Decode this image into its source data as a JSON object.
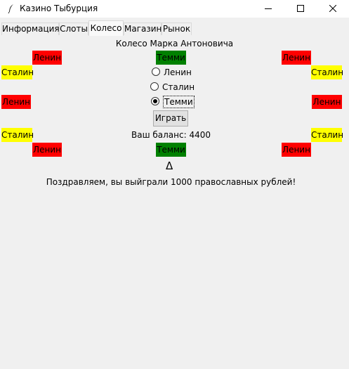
{
  "window": {
    "title": "Казино Тыбурция",
    "icon": "feather-icon"
  },
  "tabs": [
    {
      "label": "Информация"
    },
    {
      "label": "Слоты"
    },
    {
      "label": "Колесо",
      "active": true
    },
    {
      "label": "Магазин"
    },
    {
      "label": "Рынок"
    }
  ],
  "wheel": {
    "title": "Колесо Марка Антоновича",
    "segments": {
      "top_left": "Ленин",
      "top_center": "Темми",
      "top_right": "Ленин",
      "row2_left": "Сталин",
      "row2_right": "Сталин",
      "row3_left": "Ленин",
      "row3_right": "Ленин",
      "row4_left": "Сталин",
      "row4_right": "Сталин",
      "bottom_left": "Ленин",
      "bottom_center": "Темми",
      "bottom_right": "Ленин"
    },
    "colors": {
      "lenin": "#ff0000",
      "stalin": "#ffff00",
      "temmi": "#008000"
    }
  },
  "bets": {
    "options": [
      "Ленин",
      "Сталин",
      "Темми"
    ],
    "selected": "Темми"
  },
  "play_label": "Играть",
  "balance_text": "Ваш баланс: 4400",
  "pointer": "Δ",
  "result_message": "Поздравляем, вы выйграли 1000 православных рублей!"
}
